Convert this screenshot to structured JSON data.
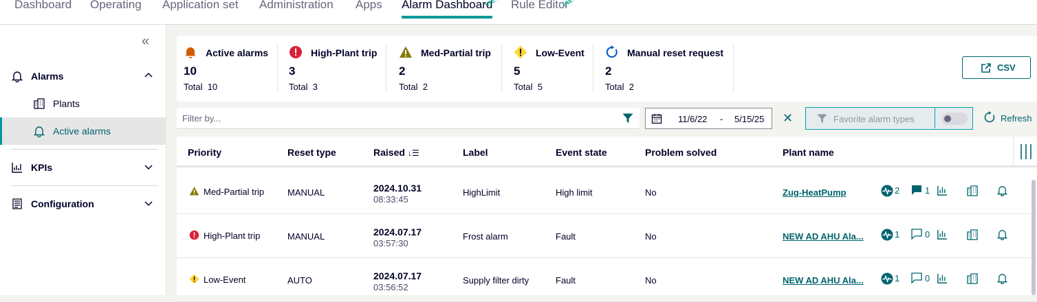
{
  "topnav": {
    "tabs": [
      {
        "label": "Dashboard"
      },
      {
        "label": "Operating"
      },
      {
        "label": "Application set"
      },
      {
        "label": "Administration"
      },
      {
        "label": "Apps"
      },
      {
        "label": "Alarm Dashboard",
        "badge": "VIEW"
      },
      {
        "label": "Rule Editor",
        "badge": "VIEW"
      }
    ],
    "active_tab": "Alarm Dashboard"
  },
  "sidebar": {
    "collapse_icon": "double-chevron-left-icon",
    "sections": [
      {
        "label": "Alarms",
        "icon": "bell-icon",
        "expanded": true,
        "items": [
          {
            "label": "Plants",
            "icon": "building-icon"
          },
          {
            "label": "Active alarms",
            "icon": "bell-icon",
            "active": true
          }
        ]
      },
      {
        "label": "KPIs",
        "icon": "bar-chart-icon",
        "expanded": false
      },
      {
        "label": "Configuration",
        "icon": "configuration-icon",
        "expanded": false
      }
    ]
  },
  "summary": {
    "cards": [
      {
        "title": "Active alarms",
        "count": "10",
        "total_label": "Total",
        "total": "10",
        "icon": "bell-filled-icon",
        "color": "#d15b00"
      },
      {
        "title": "High-Plant trip",
        "count": "3",
        "total_label": "Total",
        "total": "3",
        "icon": "alarm-high-icon",
        "color": "#d72339"
      },
      {
        "title": "Med-Partial trip",
        "count": "2",
        "total_label": "Total",
        "total": "2",
        "icon": "warning-triangle-icon",
        "color": "#877a00"
      },
      {
        "title": "Low-Event",
        "count": "5",
        "total_label": "Total",
        "total": "5",
        "icon": "warning-diamond-icon",
        "color": "#ffd732"
      },
      {
        "title": "Manual reset request",
        "count": "2",
        "total_label": "Total",
        "total": "2",
        "icon": "reset-icon",
        "color": "#0057c6"
      }
    ],
    "csv_label": "CSV"
  },
  "filterbar": {
    "placeholder": "Filter by...",
    "date_from": "11/6/22",
    "date_sep": "-",
    "date_to": "5/15/25",
    "favorite_label": "Favorite alarm types",
    "favorite_enabled": false,
    "refresh_label": "Refresh"
  },
  "table": {
    "columns": {
      "priority": "Priority",
      "reset_type": "Reset type",
      "raised": "Raised",
      "label": "Label",
      "event_state": "Event state",
      "problem_solved": "Problem solved",
      "plant_name": "Plant name"
    },
    "rows": [
      {
        "priority": "Med-Partial trip",
        "priority_icon": "warning-triangle-icon",
        "reset_type": "MANUAL",
        "raised_date": "2024.10.31",
        "raised_time": "08:33:45",
        "label": "HighLimit",
        "event_state": "High limit",
        "problem_solved": "No",
        "plant_name": "Zug-HeatPump",
        "events": "2",
        "comments": "1"
      },
      {
        "priority": "High-Plant trip",
        "priority_icon": "alarm-high-icon",
        "reset_type": "MANUAL",
        "raised_date": "2024.07.17",
        "raised_time": "03:57:30",
        "label": "Frost alarm",
        "event_state": "Fault",
        "problem_solved": "No",
        "plant_name": "NEW AD AHU Ala...",
        "events": "1",
        "comments": "0"
      },
      {
        "priority": "Low-Event",
        "priority_icon": "warning-diamond-icon",
        "reset_type": "AUTO",
        "raised_date": "2024.07.17",
        "raised_time": "03:56:52",
        "label": "Supply filter dirty",
        "event_state": "Fault",
        "problem_solved": "No",
        "plant_name": "NEW AD AHU Ala...",
        "events": "1",
        "comments": "0"
      }
    ]
  },
  "colors": {
    "accent": "#009999",
    "link": "#00646e"
  }
}
